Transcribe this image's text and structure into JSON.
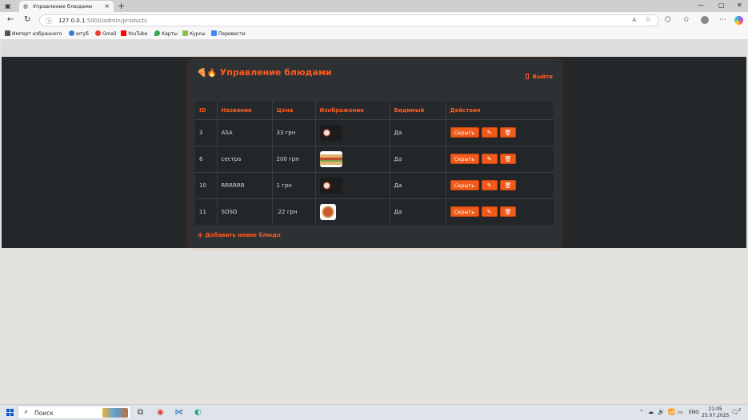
{
  "browser": {
    "tab_title": "Управление блюдами",
    "tab_close": "×",
    "new_tab": "+",
    "url_host": "127.0.0.1",
    "url_path": ":5000/admin/products",
    "bookmarks": [
      {
        "label": "Импорт избранного",
        "color": "#555555"
      },
      {
        "label": "ютуб",
        "color": "#3a7bd5"
      },
      {
        "label": "Gmail",
        "color": "#ea4335"
      },
      {
        "label": "YouTube",
        "color": "#ff0000"
      },
      {
        "label": "Карты",
        "color": "#34a853"
      },
      {
        "label": "Курсы",
        "color": "#8bc34a"
      },
      {
        "label": "Перевести",
        "color": "#4285f4"
      }
    ]
  },
  "page": {
    "title_emoji": "🍕🔥",
    "title": "Управление блюдами",
    "logout_label": "Выйти",
    "columns": [
      "ID",
      "Название",
      "Цена",
      "Изображение",
      "Видимый",
      "Действия"
    ],
    "products": [
      {
        "id": "3",
        "name": "ASA",
        "price": "33 грн",
        "image": "rolls",
        "visible": "Да",
        "hide_label": "Скрыть"
      },
      {
        "id": "6",
        "name": "сестра",
        "price": "200 грн",
        "image": "sandwich",
        "visible": "Да",
        "hide_label": "Скрыть"
      },
      {
        "id": "10",
        "name": "RRRRRR",
        "price": "1 грн",
        "image": "rolls",
        "visible": "Да",
        "hide_label": "Скрыть"
      },
      {
        "id": "11",
        "name": "SOSO",
        "price": ".22 грн",
        "image": "pizza",
        "visible": "Да",
        "hide_label": "Скрыть"
      }
    ],
    "edit_icon": "✎",
    "delete_icon": "🗑",
    "add_label": "Добавить новое блюдо",
    "accent_color": "#ff5a1f"
  },
  "taskbar": {
    "search_placeholder": "Поиск",
    "lang": "ENG",
    "time": "21:05",
    "date": "25.07.2025",
    "notifications": "2"
  }
}
